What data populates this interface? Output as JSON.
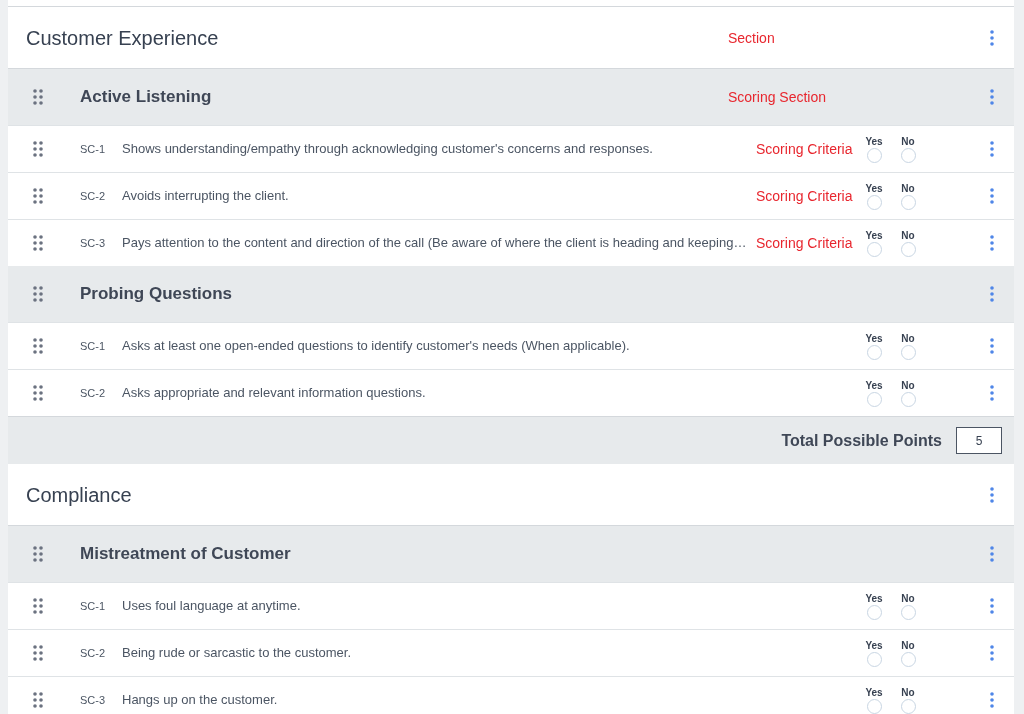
{
  "sections": [
    {
      "title": "Customer Experience",
      "annotation": "Section",
      "groups": [
        {
          "title": "Active Listening",
          "annotation": "Scoring Section",
          "criteria": [
            {
              "code": "SC-1",
              "text": "Shows understanding/empathy through acknowledging customer's concerns and responses.",
              "annotation": "Scoring Criteria",
              "options": [
                {
                  "label": "Yes",
                  "selected": false
                },
                {
                  "label": "No",
                  "selected": false
                }
              ]
            },
            {
              "code": "SC-2",
              "text": "Avoids interrupting the client.",
              "annotation": "Scoring Criteria",
              "options": [
                {
                  "label": "Yes",
                  "selected": false
                },
                {
                  "label": "No",
                  "selected": false
                }
              ]
            },
            {
              "code": "SC-3",
              "text": "Pays attention to the content and direction of the call (Be aware of where the client is heading and keeping…",
              "annotation": "Scoring Criteria",
              "options": [
                {
                  "label": "Yes",
                  "selected": false
                },
                {
                  "label": "No",
                  "selected": false
                }
              ]
            }
          ]
        },
        {
          "title": "Probing Questions",
          "criteria": [
            {
              "code": "SC-1",
              "text": "Asks at least one open-ended questions to identify customer's needs (When applicable).",
              "options": [
                {
                  "label": "Yes",
                  "selected": false
                },
                {
                  "label": "No",
                  "selected": false
                }
              ]
            },
            {
              "code": "SC-2",
              "text": "Asks appropriate and relevant information questions.",
              "options": [
                {
                  "label": "Yes",
                  "selected": false
                },
                {
                  "label": "No",
                  "selected": false
                }
              ]
            }
          ]
        }
      ],
      "total": {
        "label": "Total Possible Points",
        "value": "5"
      }
    },
    {
      "title": "Compliance",
      "groups": [
        {
          "title": "Mistreatment of Customer",
          "criteria": [
            {
              "code": "SC-1",
              "text": "Uses foul language at anytime.",
              "options": [
                {
                  "label": "Yes",
                  "selected": false
                },
                {
                  "label": "No",
                  "selected": false
                }
              ]
            },
            {
              "code": "SC-2",
              "text": "Being rude or sarcastic to the customer.",
              "options": [
                {
                  "label": "Yes",
                  "selected": false
                },
                {
                  "label": "No",
                  "selected": false
                }
              ]
            },
            {
              "code": "SC-3",
              "text": "Hangs up on the customer.",
              "options": [
                {
                  "label": "Yes",
                  "selected": false
                },
                {
                  "label": "No",
                  "selected": false
                }
              ]
            }
          ]
        }
      ]
    }
  ]
}
